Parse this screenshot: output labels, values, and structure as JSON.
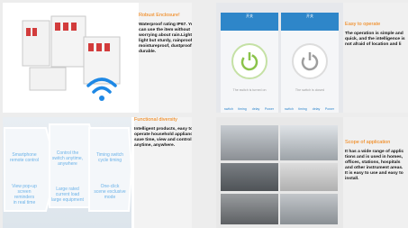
{
  "cards": [
    {
      "title": "Robust Enclosure!",
      "body": "Waterproof rating IP67. You\ncan use the item without\nworrying about rain.Lighter-\nlight but sturdy, rainproof,\nmoistureproof, dustproof and\ndurable."
    },
    {
      "title": "Easy to operate",
      "body": "The operation is simple and\nquick, and the intelligence is\nnot afraid of location and li"
    },
    {
      "title": "Functional diversity",
      "body": "Intelligent products, easy to\noperate household appliances,\nsave time, view and control\nanytime, anywhere."
    },
    {
      "title": "Scope of application",
      "body": "It has a wide range of applic\ntions and is used in homes,\noffices, stations, hospitals\nand other instrument areas.\nIt is easy to use and easy to\ninstall."
    }
  ],
  "phones": [
    {
      "title": "开关",
      "status_text": "The switch is turned on",
      "power_color": "#8bc34a"
    },
    {
      "title": "开关",
      "status_text": "The switch is closed",
      "power_color": "#9e9e9e"
    }
  ],
  "phone_tabs": [
    "switch",
    "timing",
    "delay",
    "Power"
  ],
  "features": [
    "Smartphone\nremote control",
    "Control the\nswitch anytime,\nanywhere",
    "Timing switch\ncycle timing",
    "View pop-up\nscreen\nreminders\nin real time",
    "Large rated\ncurrent load\nlarge equipment",
    "One-click\nscene exclusive\nmode"
  ],
  "colors": {
    "accent": "#f07a00",
    "wifi": "#1e88e5",
    "feature_text": "#6bb2e8",
    "app_bar": "#2e86c9"
  }
}
